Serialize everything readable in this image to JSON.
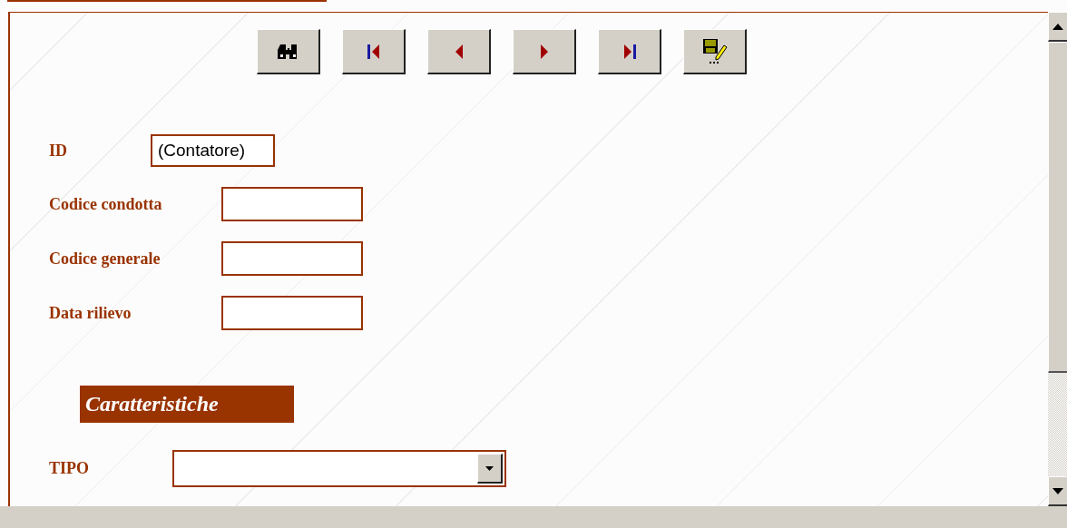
{
  "toolbar": [
    {
      "kind": "find"
    },
    {
      "kind": "first"
    },
    {
      "kind": "previous"
    },
    {
      "kind": "next"
    },
    {
      "kind": "last"
    },
    {
      "kind": "save"
    }
  ],
  "fields": [
    {
      "label": "ID",
      "value": "(Contatore)",
      "kind": "counter"
    },
    {
      "label": "Codice condotta",
      "kind": "text"
    },
    {
      "label": "Codice generale",
      "kind": "text"
    },
    {
      "label": "Data rilievo",
      "kind": "text"
    }
  ],
  "section": {
    "title": "Caratteristiche"
  },
  "tipo": {
    "label": "TIPO"
  }
}
